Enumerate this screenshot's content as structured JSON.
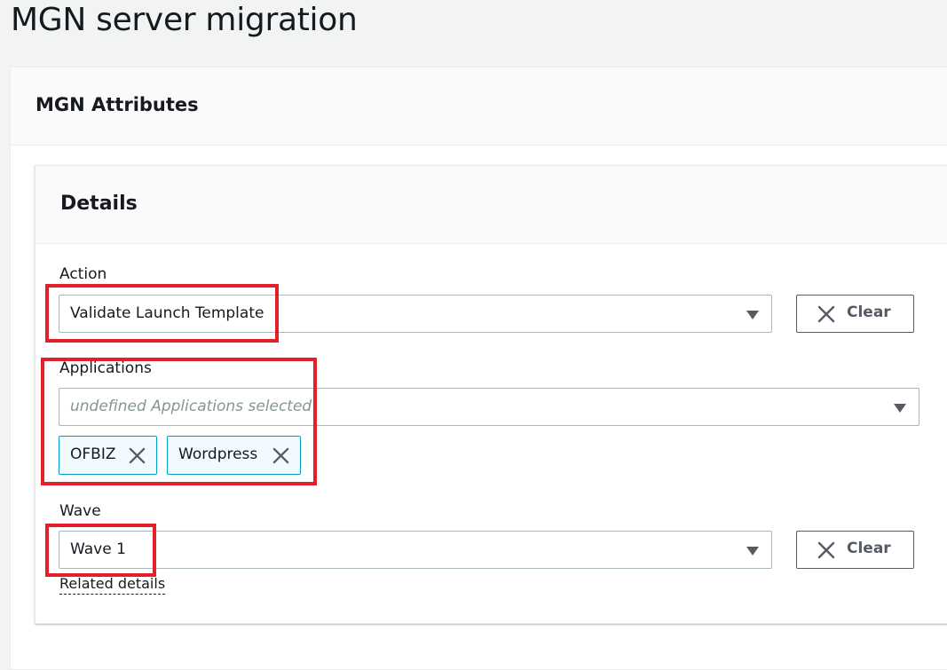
{
  "page": {
    "title": "MGN server migration"
  },
  "outer_card": {
    "title": "MGN Attributes"
  },
  "details": {
    "title": "Details",
    "action": {
      "label": "Action",
      "value": "Validate Launch Template",
      "clear_label": "Clear"
    },
    "applications": {
      "label": "Applications",
      "placeholder": "undefined Applications selected",
      "tokens": [
        "OFBIZ",
        "Wordpress"
      ]
    },
    "wave": {
      "label": "Wave",
      "value": "Wave 1",
      "clear_label": "Clear"
    },
    "related_link": "Related details"
  },
  "icons": {
    "select_caret": "caret-down-icon",
    "clear": "close-icon",
    "token_dismiss": "close-icon"
  },
  "colors": {
    "highlight": "#e3202a",
    "token_border": "#00a1c9",
    "token_bg": "#f1faff"
  }
}
